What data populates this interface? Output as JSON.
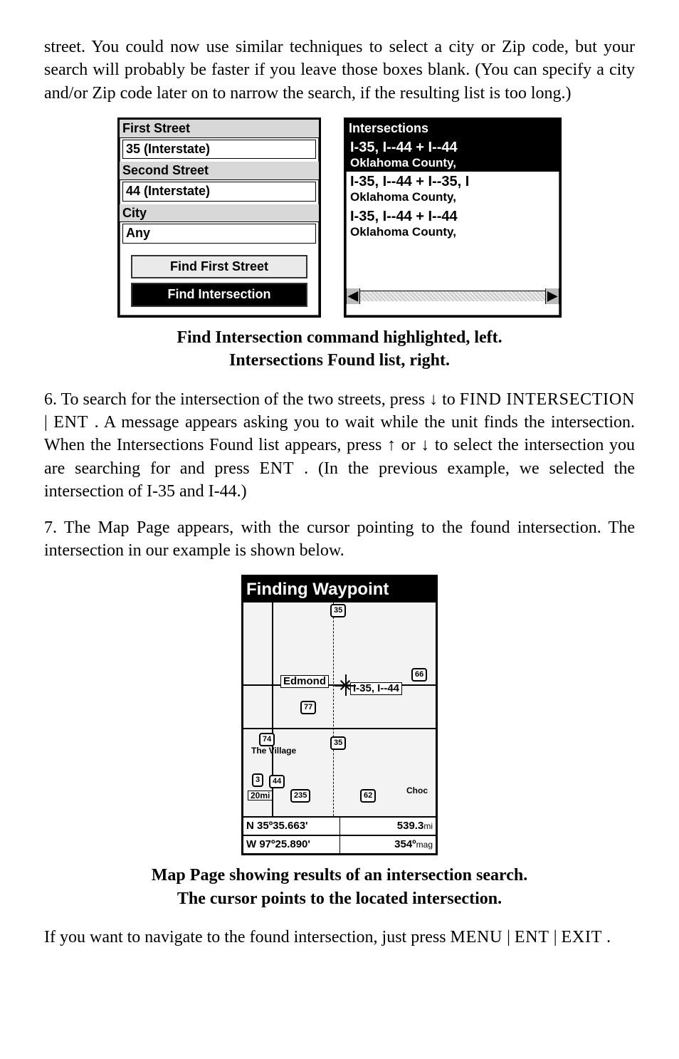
{
  "intro": "street. You could now use similar techniques to select a city or Zip code, but your search will probably be faster if you leave those boxes blank. (You can specify a city and/or Zip code later on to narrow the search, if the resulting list is too long.)",
  "screenL": {
    "first_label": "First Street",
    "first_value": "35 (Interstate)",
    "second_label": "Second Street",
    "second_value": "44 (Interstate)",
    "city_label": "City",
    "city_value": "Any",
    "btn_find_first": "Find First Street",
    "btn_find_inters": "Find Intersection"
  },
  "screenR": {
    "title": "Intersections",
    "items": [
      {
        "l1": "I-35,  I--44  +  I--44",
        "l2": "Oklahoma County,"
      },
      {
        "l1": "I-35,  I--44  +  I--35,  I",
        "l2": "Oklahoma County,"
      },
      {
        "l1": "I-35,  I--44  +  I--44",
        "l2": "Oklahoma County,"
      }
    ]
  },
  "cap1a": "Find Intersection command highlighted, left.",
  "cap1b": "Intersections Found list, right.",
  "step6a": "6.  To  search  for  the  intersection  of  the  two  streets,  press  ↓  to ",
  "step6_kbd1": "FIND INTERSECTION",
  "step6_sep": " | ",
  "step6_kbd2": "ENT",
  "step6b": ". A message appears asking you to wait while the unit finds the intersection. When the Intersections Found list appears, press ↑ or ↓ to select the intersection you are searching for and press ",
  "step6_kbd3": "ENT",
  "step6c": ". (In the previous example, we selected the intersection of I-35 and I-44.)",
  "step7": "7. The Map Page appears, with the cursor pointing to the found intersection. The intersection in our example is shown below.",
  "map": {
    "title": "Finding Waypoint",
    "edmond": "Edmond",
    "inters": "I-35, I--44",
    "village": "The Village",
    "choc": "Choc",
    "scale": "20mi",
    "lat_prefix": "N",
    "lat": "35º35.663'",
    "lon_prefix": "W",
    "lon": "97º25.890'",
    "dist": "539.3",
    "dist_unit": "mi",
    "brg": "354º",
    "brg_unit": "mag",
    "shields": {
      "s35t": "35",
      "s66": "66",
      "s77": "77",
      "s74": "74",
      "s35m": "35",
      "s3": "3",
      "s44": "44",
      "s235": "235",
      "s62": "62"
    }
  },
  "cap2a": "Map Page showing results of an intersection search.",
  "cap2b": "The cursor points to the located intersection.",
  "outroA": "If   you   want   to   navigate   to   the   found   intersection,   just   press ",
  "outro_k1": "MENU",
  "outro_s1": " | ",
  "outro_k2": "ENT",
  "outro_s2": " | ",
  "outro_k3": "EXIT",
  "outro_end": "."
}
